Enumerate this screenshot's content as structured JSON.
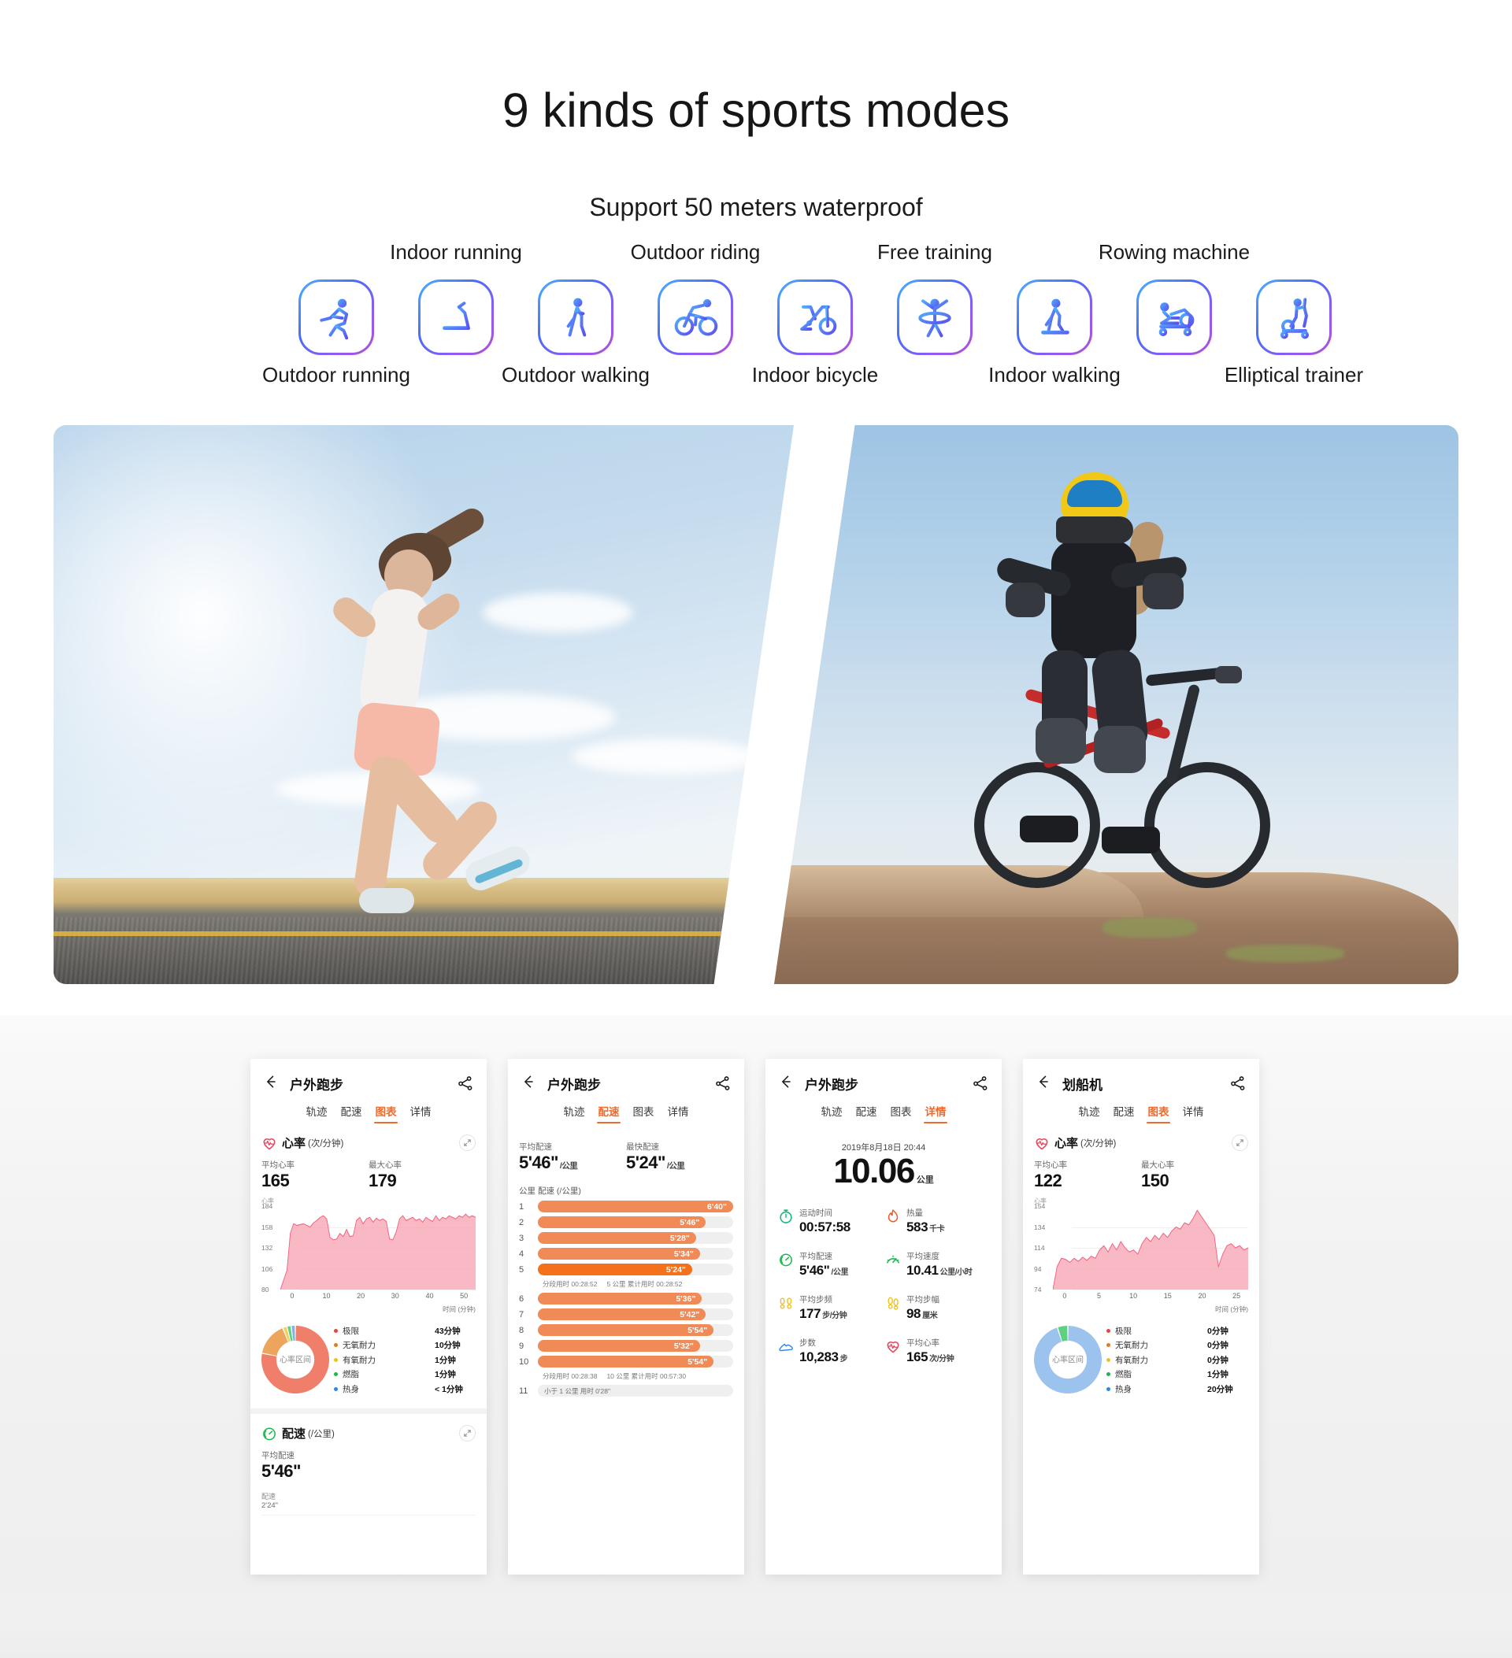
{
  "header": {
    "title": "9 kinds of sports modes",
    "subtitle": "Support 50 meters waterproof"
  },
  "sport_modes": [
    {
      "label": "Outdoor running",
      "icon": "outdoor-running-icon",
      "row": "down"
    },
    {
      "label": "Indoor running",
      "icon": "treadmill-icon",
      "row": "up"
    },
    {
      "label": "Outdoor walking",
      "icon": "outdoor-walking-icon",
      "row": "down"
    },
    {
      "label": "Outdoor riding",
      "icon": "outdoor-riding-icon",
      "row": "up"
    },
    {
      "label": "Indoor bicycle",
      "icon": "indoor-bicycle-icon",
      "row": "down"
    },
    {
      "label": "Free training",
      "icon": "free-training-icon",
      "row": "up"
    },
    {
      "label": "Indoor walking",
      "icon": "indoor-walking-icon",
      "row": "down"
    },
    {
      "label": "Rowing machine",
      "icon": "rowing-machine-icon",
      "row": "up"
    },
    {
      "label": "Elliptical trainer",
      "icon": "elliptical-trainer-icon",
      "row": "down"
    }
  ],
  "colors": {
    "accent_orange": "#ee6b2d",
    "icon_gradient_start": "#4facfe",
    "icon_gradient_end": "#b14fd8",
    "hr_pink": "#f4899c",
    "zone_blue": "#9cc3ee",
    "zone_green": "#5fd07f"
  },
  "photos": {
    "left_alt": "woman running on desert road",
    "right_alt": "woman mountain biking on rock"
  },
  "phones": [
    {
      "id": "phone-chart-running",
      "back_icon": "back-arrow-icon",
      "title": "户外跑步",
      "share_icon": "share-icon",
      "tabs": [
        {
          "label": "轨迹",
          "active": false
        },
        {
          "label": "配速",
          "active": false
        },
        {
          "label": "图表",
          "active": true
        },
        {
          "label": "详情",
          "active": false
        }
      ],
      "hr_section": {
        "icon": "heart-rate-icon",
        "name": "心率",
        "unit": "(次/分钟)",
        "expand_icon": "expand-icon",
        "avg_label": "平均心率",
        "avg_value": "165",
        "max_label": "最大心率",
        "max_value": "179",
        "y_axis_name": "心率",
        "y_ticks": [
          "184",
          "158",
          "132",
          "106",
          "80"
        ],
        "x_ticks": [
          "0",
          "10",
          "20",
          "30",
          "40",
          "50"
        ],
        "x_axis_name": "时间 (分钟)"
      },
      "zones": {
        "center_label": "心率区间",
        "rows": [
          {
            "name": "极限",
            "value": "43分钟",
            "color": "#e8453c"
          },
          {
            "name": "无氧耐力",
            "value": "10分钟",
            "color": "#e07c1e"
          },
          {
            "name": "有氧耐力",
            "value": "1分钟",
            "color": "#f2c218"
          },
          {
            "name": "燃脂",
            "value": "1分钟",
            "color": "#17b84f"
          },
          {
            "name": "热身",
            "value": "< 1分钟",
            "color": "#2f86e8"
          }
        ],
        "slices": [
          {
            "color": "#ef7f6b",
            "pct": 78
          },
          {
            "color": "#eda55e",
            "pct": 16
          },
          {
            "color": "#f2d05e",
            "pct": 2
          },
          {
            "color": "#5fd07f",
            "pct": 2
          },
          {
            "color": "#7fb3e8",
            "pct": 2
          }
        ]
      },
      "pace_section": {
        "icon": "pace-icon",
        "name": "配速",
        "unit": "(/公里)",
        "expand_icon": "expand-icon",
        "avg_label": "平均配速",
        "avg_value": "5'46\"",
        "small_label": "配速",
        "small_value": "2'24\""
      }
    },
    {
      "id": "phone-pace-running",
      "back_icon": "back-arrow-icon",
      "title": "户外跑步",
      "share_icon": "share-icon",
      "tabs": [
        {
          "label": "轨迹",
          "active": false
        },
        {
          "label": "配速",
          "active": true
        },
        {
          "label": "图表",
          "active": false
        },
        {
          "label": "详情",
          "active": false
        }
      ],
      "avg_label": "平均配速",
      "avg_value": "5'46\"",
      "avg_unit": "/公里",
      "best_label": "最快配速",
      "best_value": "5'24\"",
      "best_unit": "/公里",
      "table_head_km": "公里",
      "table_head_pace": "配速 (/公里)",
      "rows": [
        {
          "idx": "1",
          "pace": "6'40\"",
          "pct": 100,
          "best": false
        },
        {
          "idx": "2",
          "pace": "5'46\"",
          "pct": 86,
          "best": false
        },
        {
          "idx": "3",
          "pace": "5'28\"",
          "pct": 81,
          "best": false
        },
        {
          "idx": "4",
          "pace": "5'34\"",
          "pct": 83,
          "best": false
        },
        {
          "idx": "5",
          "pace": "5'24\"",
          "pct": 79,
          "best": true
        }
      ],
      "note1": {
        "a": "分段用时 00:28:52",
        "b": "5 公里 累计用时 00:28:52"
      },
      "rows2": [
        {
          "idx": "6",
          "pace": "5'36\"",
          "pct": 84,
          "best": false
        },
        {
          "idx": "7",
          "pace": "5'42\"",
          "pct": 86,
          "best": false
        },
        {
          "idx": "8",
          "pace": "5'54\"",
          "pct": 90,
          "best": false
        },
        {
          "idx": "9",
          "pace": "5'32\"",
          "pct": 83,
          "best": false
        },
        {
          "idx": "10",
          "pace": "5'54\"",
          "pct": 90,
          "best": false
        }
      ],
      "note2": {
        "a": "分段用时 00:28:38",
        "b": "10 公里 累计用时 00:57:30"
      },
      "last_row": {
        "idx": "11",
        "text": "小于 1 公里 用时 0'28\""
      }
    },
    {
      "id": "phone-detail-running",
      "back_icon": "back-arrow-icon",
      "title": "户外跑步",
      "share_icon": "share-icon",
      "tabs": [
        {
          "label": "轨迹",
          "active": false
        },
        {
          "label": "配速",
          "active": false
        },
        {
          "label": "图表",
          "active": false
        },
        {
          "label": "详情",
          "active": true
        }
      ],
      "date": "2019年8月18日 20:44",
      "distance_value": "10.06",
      "distance_unit": "公里",
      "metrics": [
        {
          "icon": "stopwatch-icon",
          "color": "#17b87a",
          "label": "运动时间",
          "value": "00:57:58",
          "unit": ""
        },
        {
          "icon": "flame-icon",
          "color": "#ee5a24",
          "label": "热量",
          "value": "583",
          "unit": "千卡"
        },
        {
          "icon": "pace-icon",
          "color": "#17b84f",
          "label": "平均配速",
          "value": "5'46\"",
          "unit": "/公里"
        },
        {
          "icon": "speed-icon",
          "color": "#17b84f",
          "label": "平均速度",
          "value": "10.41",
          "unit": "公里/小时"
        },
        {
          "icon": "cadence-icon",
          "color": "#f2c218",
          "label": "平均步频",
          "value": "177",
          "unit": "步/分钟"
        },
        {
          "icon": "stride-icon",
          "color": "#f2c218",
          "label": "平均步幅",
          "value": "98",
          "unit": "厘米"
        },
        {
          "icon": "shoe-icon",
          "color": "#2f86e8",
          "label": "步数",
          "value": "10,283",
          "unit": "步"
        },
        {
          "icon": "heart-rate-icon",
          "color": "#e8455f",
          "label": "平均心率",
          "value": "165",
          "unit": "次/分钟"
        }
      ]
    },
    {
      "id": "phone-chart-rowing",
      "back_icon": "back-arrow-icon",
      "title": "划船机",
      "share_icon": "share-icon",
      "tabs": [
        {
          "label": "轨迹",
          "active": false
        },
        {
          "label": "配速",
          "active": false
        },
        {
          "label": "图表",
          "active": true
        },
        {
          "label": "详情",
          "active": false
        }
      ],
      "hr_section": {
        "icon": "heart-rate-icon",
        "name": "心率",
        "unit": "(次/分钟)",
        "expand_icon": "expand-icon",
        "avg_label": "平均心率",
        "avg_value": "122",
        "max_label": "最大心率",
        "max_value": "150",
        "y_axis_name": "心率",
        "y_ticks": [
          "154",
          "134",
          "114",
          "94",
          "74"
        ],
        "x_ticks": [
          "0",
          "5",
          "10",
          "15",
          "20",
          "25"
        ],
        "x_axis_name": "时间 (分钟)"
      },
      "zones": {
        "center_label": "心率区间",
        "rows": [
          {
            "name": "极限",
            "value": "0分钟",
            "color": "#e8453c"
          },
          {
            "name": "无氧耐力",
            "value": "0分钟",
            "color": "#e07c1e"
          },
          {
            "name": "有氧耐力",
            "value": "0分钟",
            "color": "#f2c218"
          },
          {
            "name": "燃脂",
            "value": "1分钟",
            "color": "#17b84f"
          },
          {
            "name": "热身",
            "value": "20分钟",
            "color": "#2f86e8"
          }
        ],
        "slices": [
          {
            "color": "#9cc3ee",
            "pct": 95
          },
          {
            "color": "#5fd07f",
            "pct": 5
          }
        ]
      }
    }
  ],
  "chart_data": [
    {
      "type": "area",
      "title": "心率 (次/分钟)",
      "xlabel": "时间 (分钟)",
      "ylabel": "心率",
      "ylim": [
        80,
        184
      ],
      "xlim": [
        0,
        54
      ],
      "yticks": [
        80,
        106,
        132,
        158,
        184
      ],
      "xticks": [
        0,
        10,
        20,
        30,
        40,
        50
      ],
      "grid": true,
      "legend": "none",
      "series": [
        {
          "name": "heart rate",
          "values": [
            80,
            92,
            104,
            150,
            162,
            160,
            161,
            162,
            160,
            158,
            163,
            166,
            170,
            172,
            168,
            145,
            142,
            143,
            150,
            146,
            155,
            146,
            147,
            166,
            170,
            162,
            168,
            170,
            164,
            169,
            166,
            168,
            165,
            143,
            142,
            152,
            168,
            172,
            166,
            168,
            170,
            166,
            168,
            164,
            170,
            167,
            165,
            172,
            166,
            170,
            168,
            172,
            170,
            168,
            172,
            170,
            174,
            170,
            172,
            170
          ]
        }
      ]
    },
    {
      "type": "pie",
      "title": "心率区间",
      "labels": [
        "极限",
        "无氧耐力",
        "有氧耐力",
        "燃脂",
        "热身"
      ],
      "values": [
        43,
        10,
        1,
        1,
        0.5
      ],
      "value_labels": [
        "43分钟",
        "10分钟",
        "1分钟",
        "1分钟",
        "< 1分钟"
      ],
      "colors": [
        "#ef7f6b",
        "#eda55e",
        "#f2d05e",
        "#5fd07f",
        "#7fb3e8"
      ]
    },
    {
      "type": "bar",
      "title": "配速 (/公里)",
      "orientation": "horizontal",
      "categories": [
        "1",
        "2",
        "3",
        "4",
        "5",
        "6",
        "7",
        "8",
        "9",
        "10"
      ],
      "value_labels": [
        "6'40\"",
        "5'46\"",
        "5'28\"",
        "5'34\"",
        "5'24\"",
        "5'36\"",
        "5'42\"",
        "5'54\"",
        "5'32\"",
        "5'54\""
      ],
      "values": [
        400,
        346,
        328,
        334,
        324,
        336,
        342,
        354,
        332,
        354
      ],
      "ylabel": "公里",
      "xlabel": "配速 (/公里)",
      "highlight_index": 4
    },
    {
      "type": "area",
      "title": "心率 (次/分钟)",
      "xlabel": "时间 (分钟)",
      "ylabel": "心率",
      "ylim": [
        74,
        154
      ],
      "xlim": [
        0,
        27
      ],
      "yticks": [
        74,
        94,
        114,
        134,
        154
      ],
      "xticks": [
        0,
        5,
        10,
        15,
        20,
        25
      ],
      "grid": true,
      "legend": "none",
      "series": [
        {
          "name": "heart rate",
          "values": [
            74,
            96,
            104,
            103,
            100,
            104,
            101,
            105,
            102,
            106,
            104,
            112,
            116,
            110,
            118,
            112,
            120,
            114,
            110,
            112,
            108,
            118,
            124,
            120,
            126,
            122,
            128,
            124,
            130,
            134,
            132,
            138,
            136,
            142,
            150,
            144,
            138,
            132,
            126,
            96,
            108,
            116,
            118,
            114,
            116,
            112,
            114
          ]
        }
      ]
    },
    {
      "type": "pie",
      "title": "心率区间",
      "labels": [
        "极限",
        "无氧耐力",
        "有氧耐力",
        "燃脂",
        "热身"
      ],
      "values": [
        0,
        0,
        0,
        1,
        20
      ],
      "value_labels": [
        "0分钟",
        "0分钟",
        "0分钟",
        "1分钟",
        "20分钟"
      ],
      "colors": [
        "#e8453c",
        "#e07c1e",
        "#f2c218",
        "#5fd07f",
        "#9cc3ee"
      ]
    }
  ]
}
